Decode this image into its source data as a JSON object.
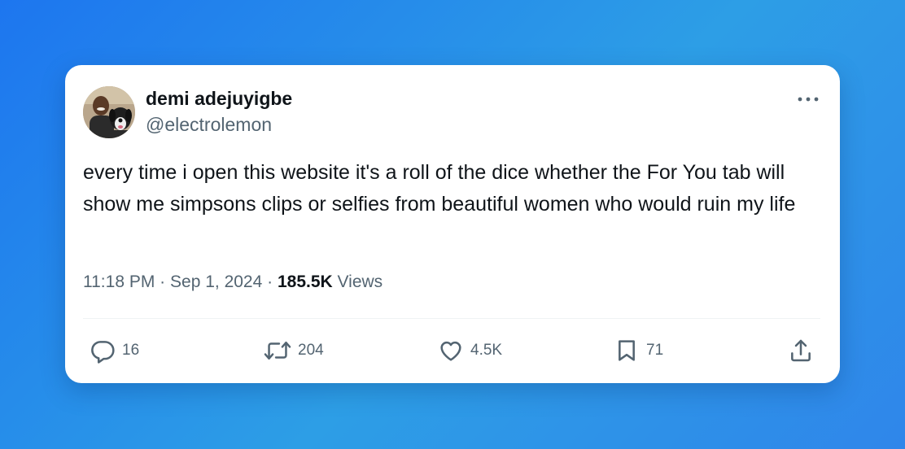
{
  "author": {
    "name": "demi adejuyigbe",
    "handle": "@electrolemon"
  },
  "tweet": {
    "text": "every time i open this website it's a roll of the dice whether the For You tab will show me simpsons clips or selfies from beautiful women who would ruin my life",
    "time": "11:18 PM",
    "separator": "·",
    "date": "Sep 1, 2024",
    "views_count": "185.5K",
    "views_label": "Views"
  },
  "actions": {
    "replies": "16",
    "reposts": "204",
    "likes": "4.5K",
    "bookmarks": "71"
  },
  "icons": [
    "more-icon",
    "reply-icon",
    "repost-icon",
    "like-icon",
    "bookmark-icon",
    "share-icon"
  ],
  "colors": {
    "text_primary": "#0f1419",
    "text_secondary": "#536471",
    "background_gradient_start": "#1d76ef",
    "background_gradient_end": "#2f86ea",
    "card": "#ffffff"
  }
}
